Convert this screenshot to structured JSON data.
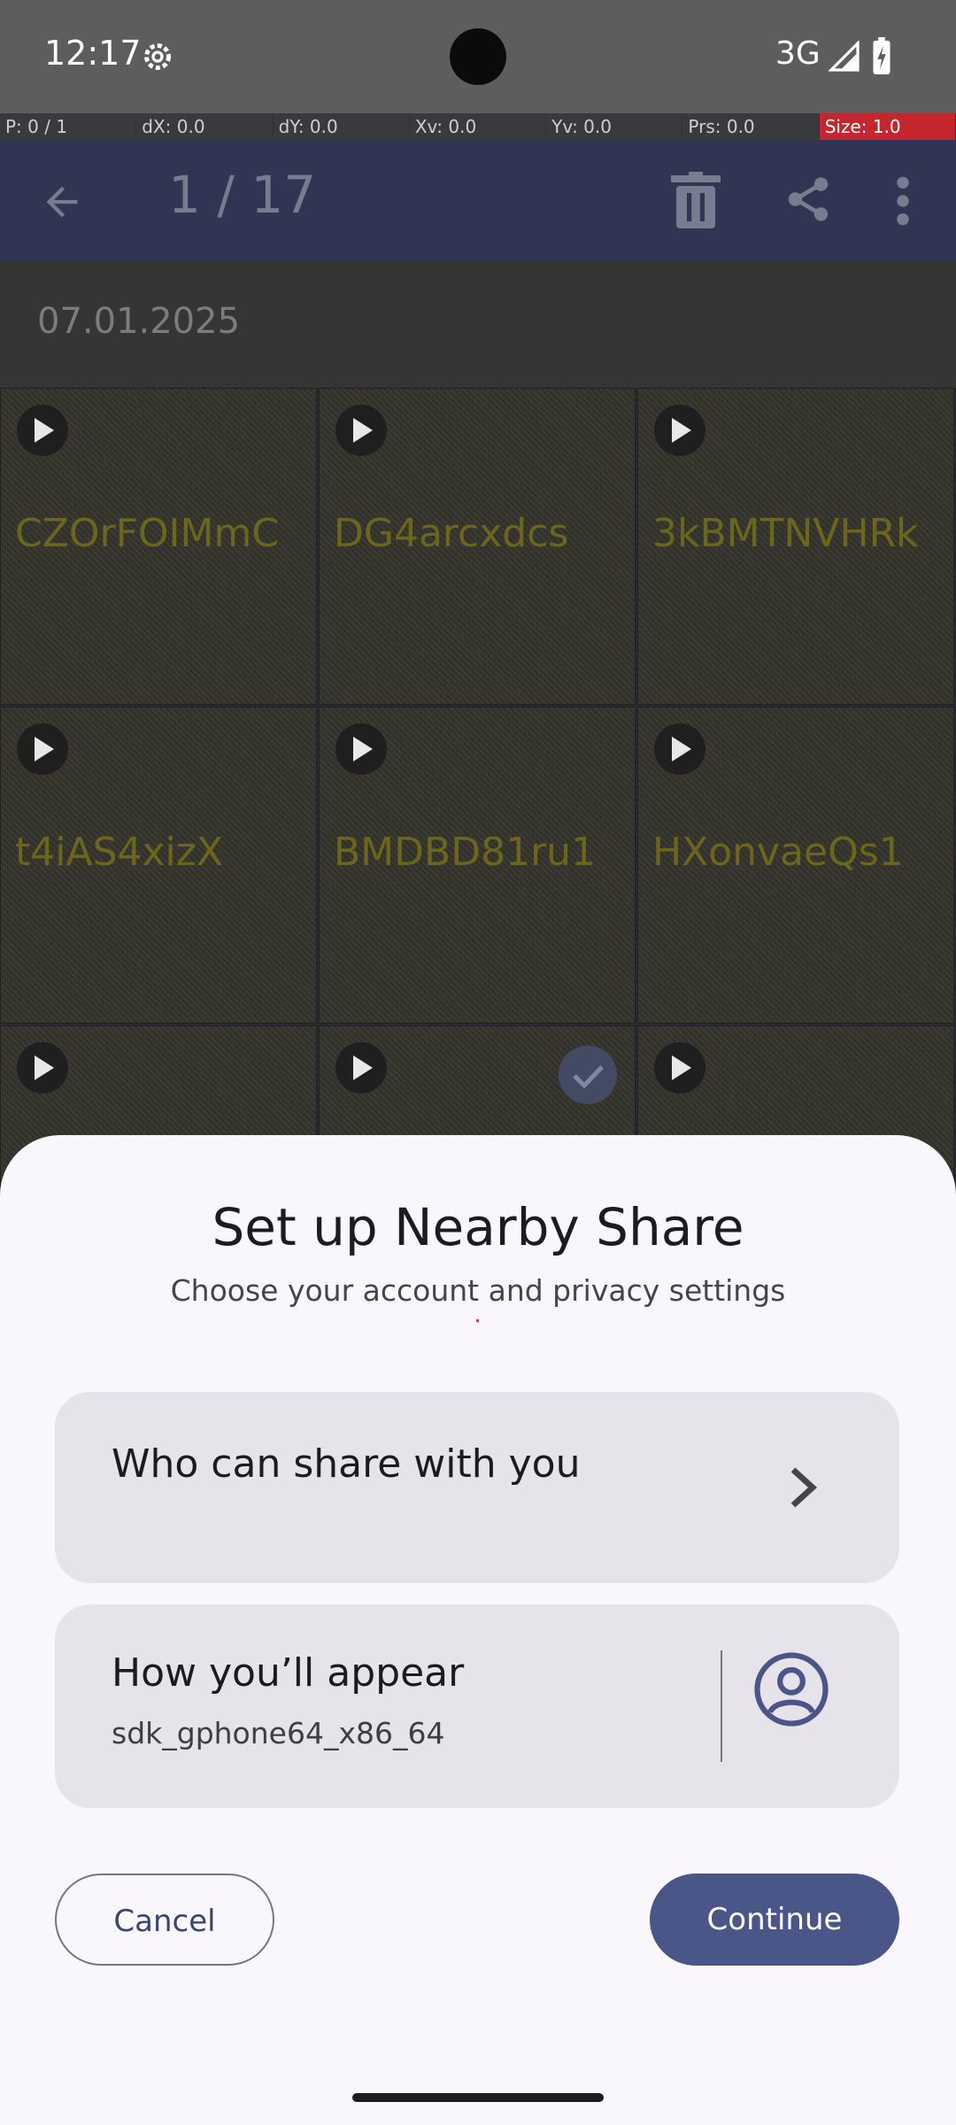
{
  "status_bar": {
    "time": "12:17",
    "network": "3G"
  },
  "debug_bar": [
    "P: 0 / 1",
    "dX: 0.0",
    "dY: 0.0",
    "Xv: 0.0",
    "Yv: 0.0",
    "Prs: 0.0",
    "Size: 1.0"
  ],
  "toolbar": {
    "title": "1 / 17"
  },
  "gallery": {
    "date": "07.01.2025",
    "items": [
      {
        "label": "CZOrFOIMmC"
      },
      {
        "label": "DG4arcxdcs"
      },
      {
        "label": "3kBMTNVHRk"
      },
      {
        "label": "t4iAS4xizX"
      },
      {
        "label": "BMDBD81ru1"
      },
      {
        "label": "HXonvaeQs1"
      },
      {
        "label": ""
      },
      {
        "label": ""
      },
      {
        "label": ""
      }
    ]
  },
  "sheet": {
    "title": "Set up Nearby Share",
    "subtitle": "Choose your account and privacy settings",
    "who_label": "Who can share with you",
    "appear_label": "How you’ll appear",
    "device_name": "sdk_gphone64_x86_64",
    "cancel_label": "Cancel",
    "continue_label": "Continue"
  },
  "colors": {
    "sheet_bg": "#f9f7fc",
    "card_bg": "#e6e4ea",
    "primary": "#4a5588",
    "toolbar_bg": "#2f3553"
  }
}
